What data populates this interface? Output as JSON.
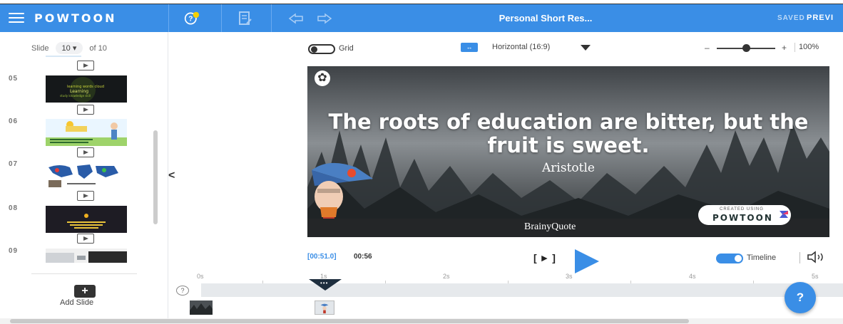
{
  "app": {
    "logo": "POWTOON",
    "title": "Personal Short Res...",
    "saved": "SAVED",
    "preview": "PREVI"
  },
  "sidebar": {
    "slide_prefix": "Slide",
    "current_slide": "10",
    "slide_total": "of 10",
    "slides": [
      {
        "num": "05",
        "kind": "dark-wordcloud"
      },
      {
        "num": "06",
        "kind": "light-cartoon"
      },
      {
        "num": "07",
        "kind": "world-map"
      },
      {
        "num": "08",
        "kind": "dark-text"
      },
      {
        "num": "09",
        "kind": "photo"
      }
    ],
    "add_slide": "Add Slide",
    "add_icon": "+"
  },
  "canvas_toolbar": {
    "grid_label": "Grid",
    "orientation_badge": "↔",
    "orientation": "Horizontal (16:9)",
    "zoom_minus": "–",
    "zoom_plus": "+",
    "zoom": "100%",
    "zoom_level_percent": 50
  },
  "stage": {
    "settings_icon": "✿",
    "quote": "The roots of education are bitter, but the fruit is sweet.",
    "author": "Aristotle",
    "watermark": "BrainyQuote",
    "badge_created": "CREATED USING",
    "badge_logo": "POWTOON"
  },
  "playback": {
    "current_time": "[00:51.0]",
    "total_time": "00:56",
    "step_label": "[ ► ]",
    "timeline_label": "Timeline"
  },
  "timeline": {
    "ticks": [
      "0s",
      "1s",
      "2s",
      "3s",
      "4s",
      "5s"
    ],
    "playhead_dots": "•••",
    "help": "?"
  },
  "fab": {
    "label": "?"
  },
  "colors": {
    "accent": "#3a8ee6",
    "topbar": "#3a8ee6",
    "dark": "#1e2e3e"
  }
}
